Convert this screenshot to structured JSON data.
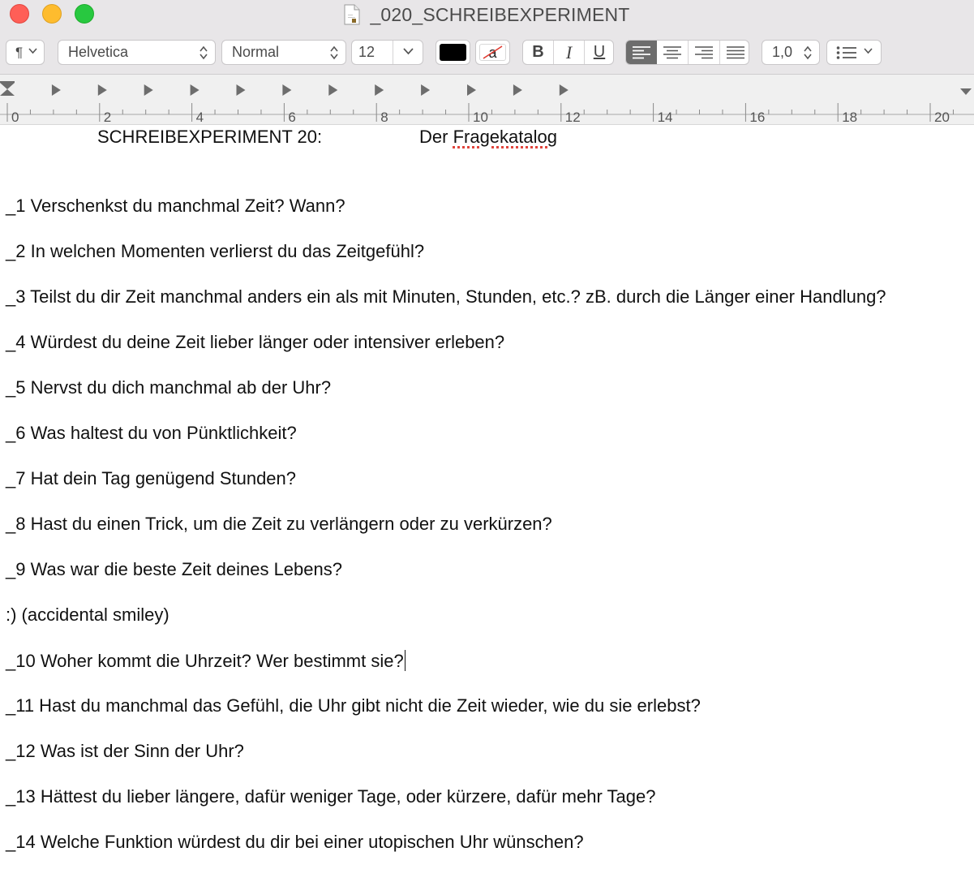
{
  "window": {
    "title": "_020_SCHREIBEXPERIMENT",
    "document_icon": "document-icon"
  },
  "toolbar": {
    "paragraph_styles_icon": "pilcrow-icon",
    "font_family": "Helvetica",
    "font_style": "Normal",
    "font_size": "12",
    "text_color": "#000000",
    "highlight_label": "a",
    "bold_label": "B",
    "italic_label": "I",
    "underline_label": "U",
    "alignment_selected": "left",
    "line_spacing": "1,0",
    "list_icon": "list-bullets-icon"
  },
  "ruler": {
    "labels": [
      "0",
      "2",
      "4",
      "6",
      "8",
      "10",
      "12",
      "14",
      "16",
      "18",
      "20"
    ]
  },
  "document": {
    "heading_left": "SCHREIBEXPERIMENT 20:",
    "heading_right_prefix": "Der ",
    "heading_right_misspelled": "Fragekatalog",
    "paragraphs": [
      "_1 Verschenkst du manchmal Zeit? Wann?",
      "_2 In welchen Momenten verlierst du das Zeitgefühl?",
      "_3 Teilst du dir Zeit manchmal anders ein als mit Minuten, Stunden, etc.? zB. durch die Länger einer Handlung?",
      "_4 Würdest du deine Zeit lieber länger oder intensiver erleben?",
      "_5 Nervst du dich manchmal ab der Uhr?",
      "_6 Was haltest du von Pünktlichkeit?",
      "_7 Hat dein Tag genügend Stunden?",
      "_8 Hast du einen Trick, um die Zeit zu verlängern oder zu verkürzen?",
      "_9 Was war die beste Zeit deines Lebens?",
      ":) (accidental smiley)",
      "_10 Woher kommt die Uhrzeit? Wer bestimmt sie?",
      "_11 Hast du manchmal das Gefühl, die Uhr gibt nicht die Zeit wieder, wie du sie erlebst?",
      "_12 Was ist der Sinn der Uhr?",
      "_13 Hättest du lieber längere, dafür weniger Tage, oder kürzere, dafür mehr Tage?",
      "_14 Welche Funktion würdest du dir bei einer utopischen Uhr wünschen?"
    ]
  }
}
